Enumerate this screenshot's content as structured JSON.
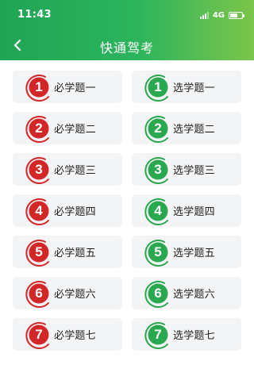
{
  "status_bar": {
    "time": "11:43",
    "network": "4G",
    "icons": [
      "signal-icon",
      "battery-icon"
    ]
  },
  "header": {
    "title": "快通驾考",
    "back_icon": "chevron-left-icon",
    "colors": {
      "start": "#1fa455",
      "end": "#7cc54a"
    }
  },
  "colors": {
    "required": "#d32626",
    "elective": "#2aa84f"
  },
  "required_items": [
    {
      "num": "1",
      "label": "必学题一"
    },
    {
      "num": "2",
      "label": "必学题二"
    },
    {
      "num": "3",
      "label": "必学题三"
    },
    {
      "num": "4",
      "label": "必学题四"
    },
    {
      "num": "5",
      "label": "必学题五"
    },
    {
      "num": "6",
      "label": "必学题六"
    },
    {
      "num": "7",
      "label": "必学题七"
    }
  ],
  "elective_items": [
    {
      "num": "1",
      "label": "选学题一"
    },
    {
      "num": "2",
      "label": "选学题二"
    },
    {
      "num": "3",
      "label": "选学题三"
    },
    {
      "num": "4",
      "label": "选学题四"
    },
    {
      "num": "5",
      "label": "选学题五"
    },
    {
      "num": "6",
      "label": "选学题六"
    },
    {
      "num": "7",
      "label": "选学题七"
    }
  ]
}
